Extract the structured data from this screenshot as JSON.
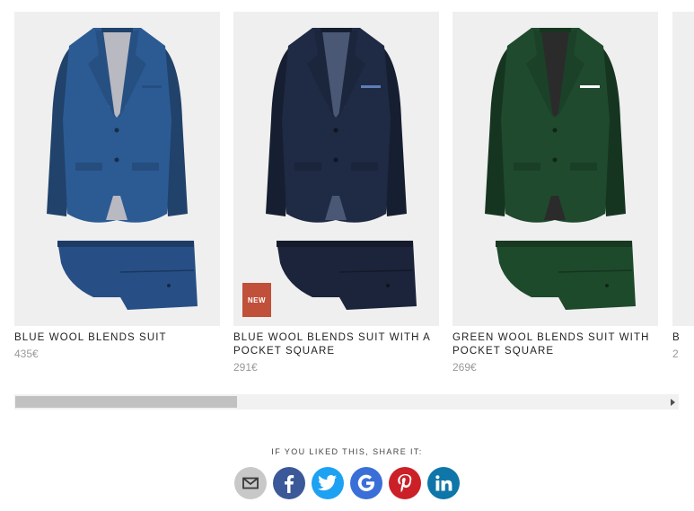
{
  "products": [
    {
      "title": "BLUE WOOL BLENDS SUIT",
      "price": "435€",
      "badge": "",
      "jacket_color": "#2c5b94",
      "pants_color": "#274f86",
      "lining_color": "#b9b9c2",
      "pocket_square": ""
    },
    {
      "title": "BLUE WOOL BLENDS SUIT WITH A POCKET SQUARE",
      "price": "291€",
      "badge": "NEW",
      "jacket_color": "#1f2a44",
      "pants_color": "#1c243b",
      "lining_color": "#4a5775",
      "pocket_square": "#5d7fb5"
    },
    {
      "title": "GREEN WOOL BLENDS SUIT WITH POCKET SQUARE",
      "price": "269€",
      "badge": "",
      "jacket_color": "#1f4a2e",
      "pants_color": "#1e4a2c",
      "lining_color": "#2b2b2b",
      "pocket_square": "#ffffff"
    },
    {
      "title": "B",
      "price": "2",
      "badge": "",
      "jacket_color": "#efefef",
      "pants_color": "#efefef",
      "lining_color": "#efefef",
      "pocket_square": ""
    }
  ],
  "scroll": {
    "position_fraction": 0.0,
    "visible_fraction": 0.34
  },
  "share": {
    "label": "IF YOU LIKED THIS, SHARE IT:",
    "buttons": [
      {
        "name": "email",
        "icon": "envelope-icon",
        "color": "#c8c8c8"
      },
      {
        "name": "facebook",
        "icon": "facebook-icon",
        "color": "#3b5998"
      },
      {
        "name": "twitter",
        "icon": "twitter-icon",
        "color": "#1da1f2"
      },
      {
        "name": "google",
        "icon": "google-icon",
        "color": "#3a6fd8"
      },
      {
        "name": "pinterest",
        "icon": "pinterest-icon",
        "color": "#cb2027"
      },
      {
        "name": "linkedin",
        "icon": "linkedin-icon",
        "color": "#0e76a8"
      }
    ]
  }
}
